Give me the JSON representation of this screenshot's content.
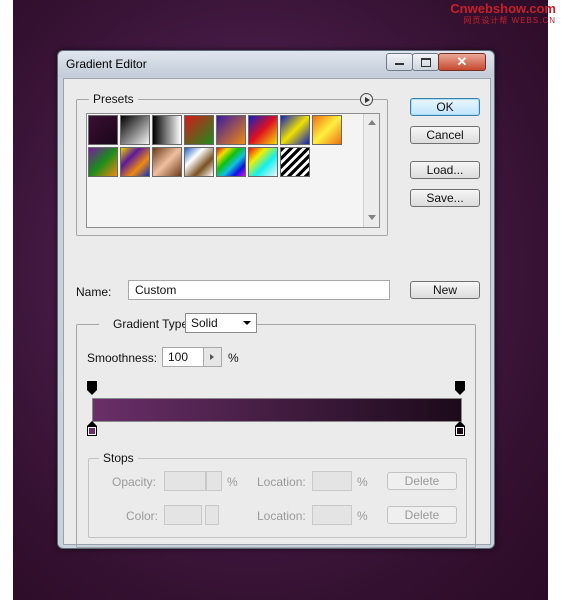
{
  "watermark": {
    "line1": "Cnwebshow.com",
    "line2": "网页设计帮 WEBS.CN"
  },
  "dialog": {
    "title": "Gradient Editor",
    "presets_label": "Presets",
    "buttons": {
      "ok": "OK",
      "cancel": "Cancel",
      "load": "Load...",
      "save": "Save...",
      "new": "New"
    },
    "name_label": "Name:",
    "name_value": "Custom",
    "gradient_type_label": "Gradient Type:",
    "gradient_type_value": "Solid",
    "smoothness_label": "Smoothness:",
    "smoothness_value": "100",
    "percent": "%",
    "gradient": {
      "start_color": "#6a2f69",
      "end_color": "#1c0a1a"
    },
    "stops": {
      "label": "Stops",
      "opacity_label": "Opacity:",
      "color_label": "Color:",
      "location_label": "Location:",
      "percent": "%",
      "delete_label": "Delete"
    }
  },
  "presets": [
    {
      "name": "foreground-to-background",
      "css": "linear-gradient(135deg,#3a0f33,#1a0618)"
    },
    {
      "name": "foreground-to-transparent",
      "css": "linear-gradient(135deg,#000 0%,rgba(0,0,0,0) 100%)"
    },
    {
      "name": "black-white",
      "css": "linear-gradient(90deg,#000,#fff)"
    },
    {
      "name": "red-green",
      "css": "linear-gradient(135deg,#d21a1a,#1d8d1d)"
    },
    {
      "name": "violet-orange",
      "css": "linear-gradient(135deg,#3a1aa0,#f08a10)"
    },
    {
      "name": "blue-red-yellow",
      "css": "linear-gradient(135deg,#1020c0,#e01020,#f0e000)"
    },
    {
      "name": "blue-yellow-blue",
      "css": "linear-gradient(135deg,#1020c0,#f0e000,#1020c0)"
    },
    {
      "name": "orange-yellow-orange",
      "css": "linear-gradient(135deg,#f07010,#fff040,#f07010)"
    },
    {
      "name": "violet-green-orange",
      "css": "linear-gradient(135deg,#7a1aa0,#1a8d1a,#f08a10)"
    },
    {
      "name": "yellow-violet-orange-blue",
      "css": "linear-gradient(135deg,#f0d000,#5a1a9a,#f08a10,#1030c0)"
    },
    {
      "name": "copper",
      "css": "linear-gradient(135deg,#6b3a1a,#f0c0a0,#6b3a1a)"
    },
    {
      "name": "chrome",
      "css": "linear-gradient(135deg,#2060c0,#ffffff,#7a5020,#ffffff)"
    },
    {
      "name": "spectrum",
      "css": "linear-gradient(135deg,#e01010,#f0e000,#10c010,#10c0e0,#1010e0,#e010e0)"
    },
    {
      "name": "transparent-rainbow",
      "css": "linear-gradient(135deg,#f01010 0%,#f0f000 30%,#10f0f0 60%,rgba(255,255,255,0) 100%)"
    },
    {
      "name": "transparent-stripes",
      "css": "repeating-linear-gradient(135deg,#000 0px,#000 3px,#fff 3px,#fff 6px)"
    }
  ]
}
